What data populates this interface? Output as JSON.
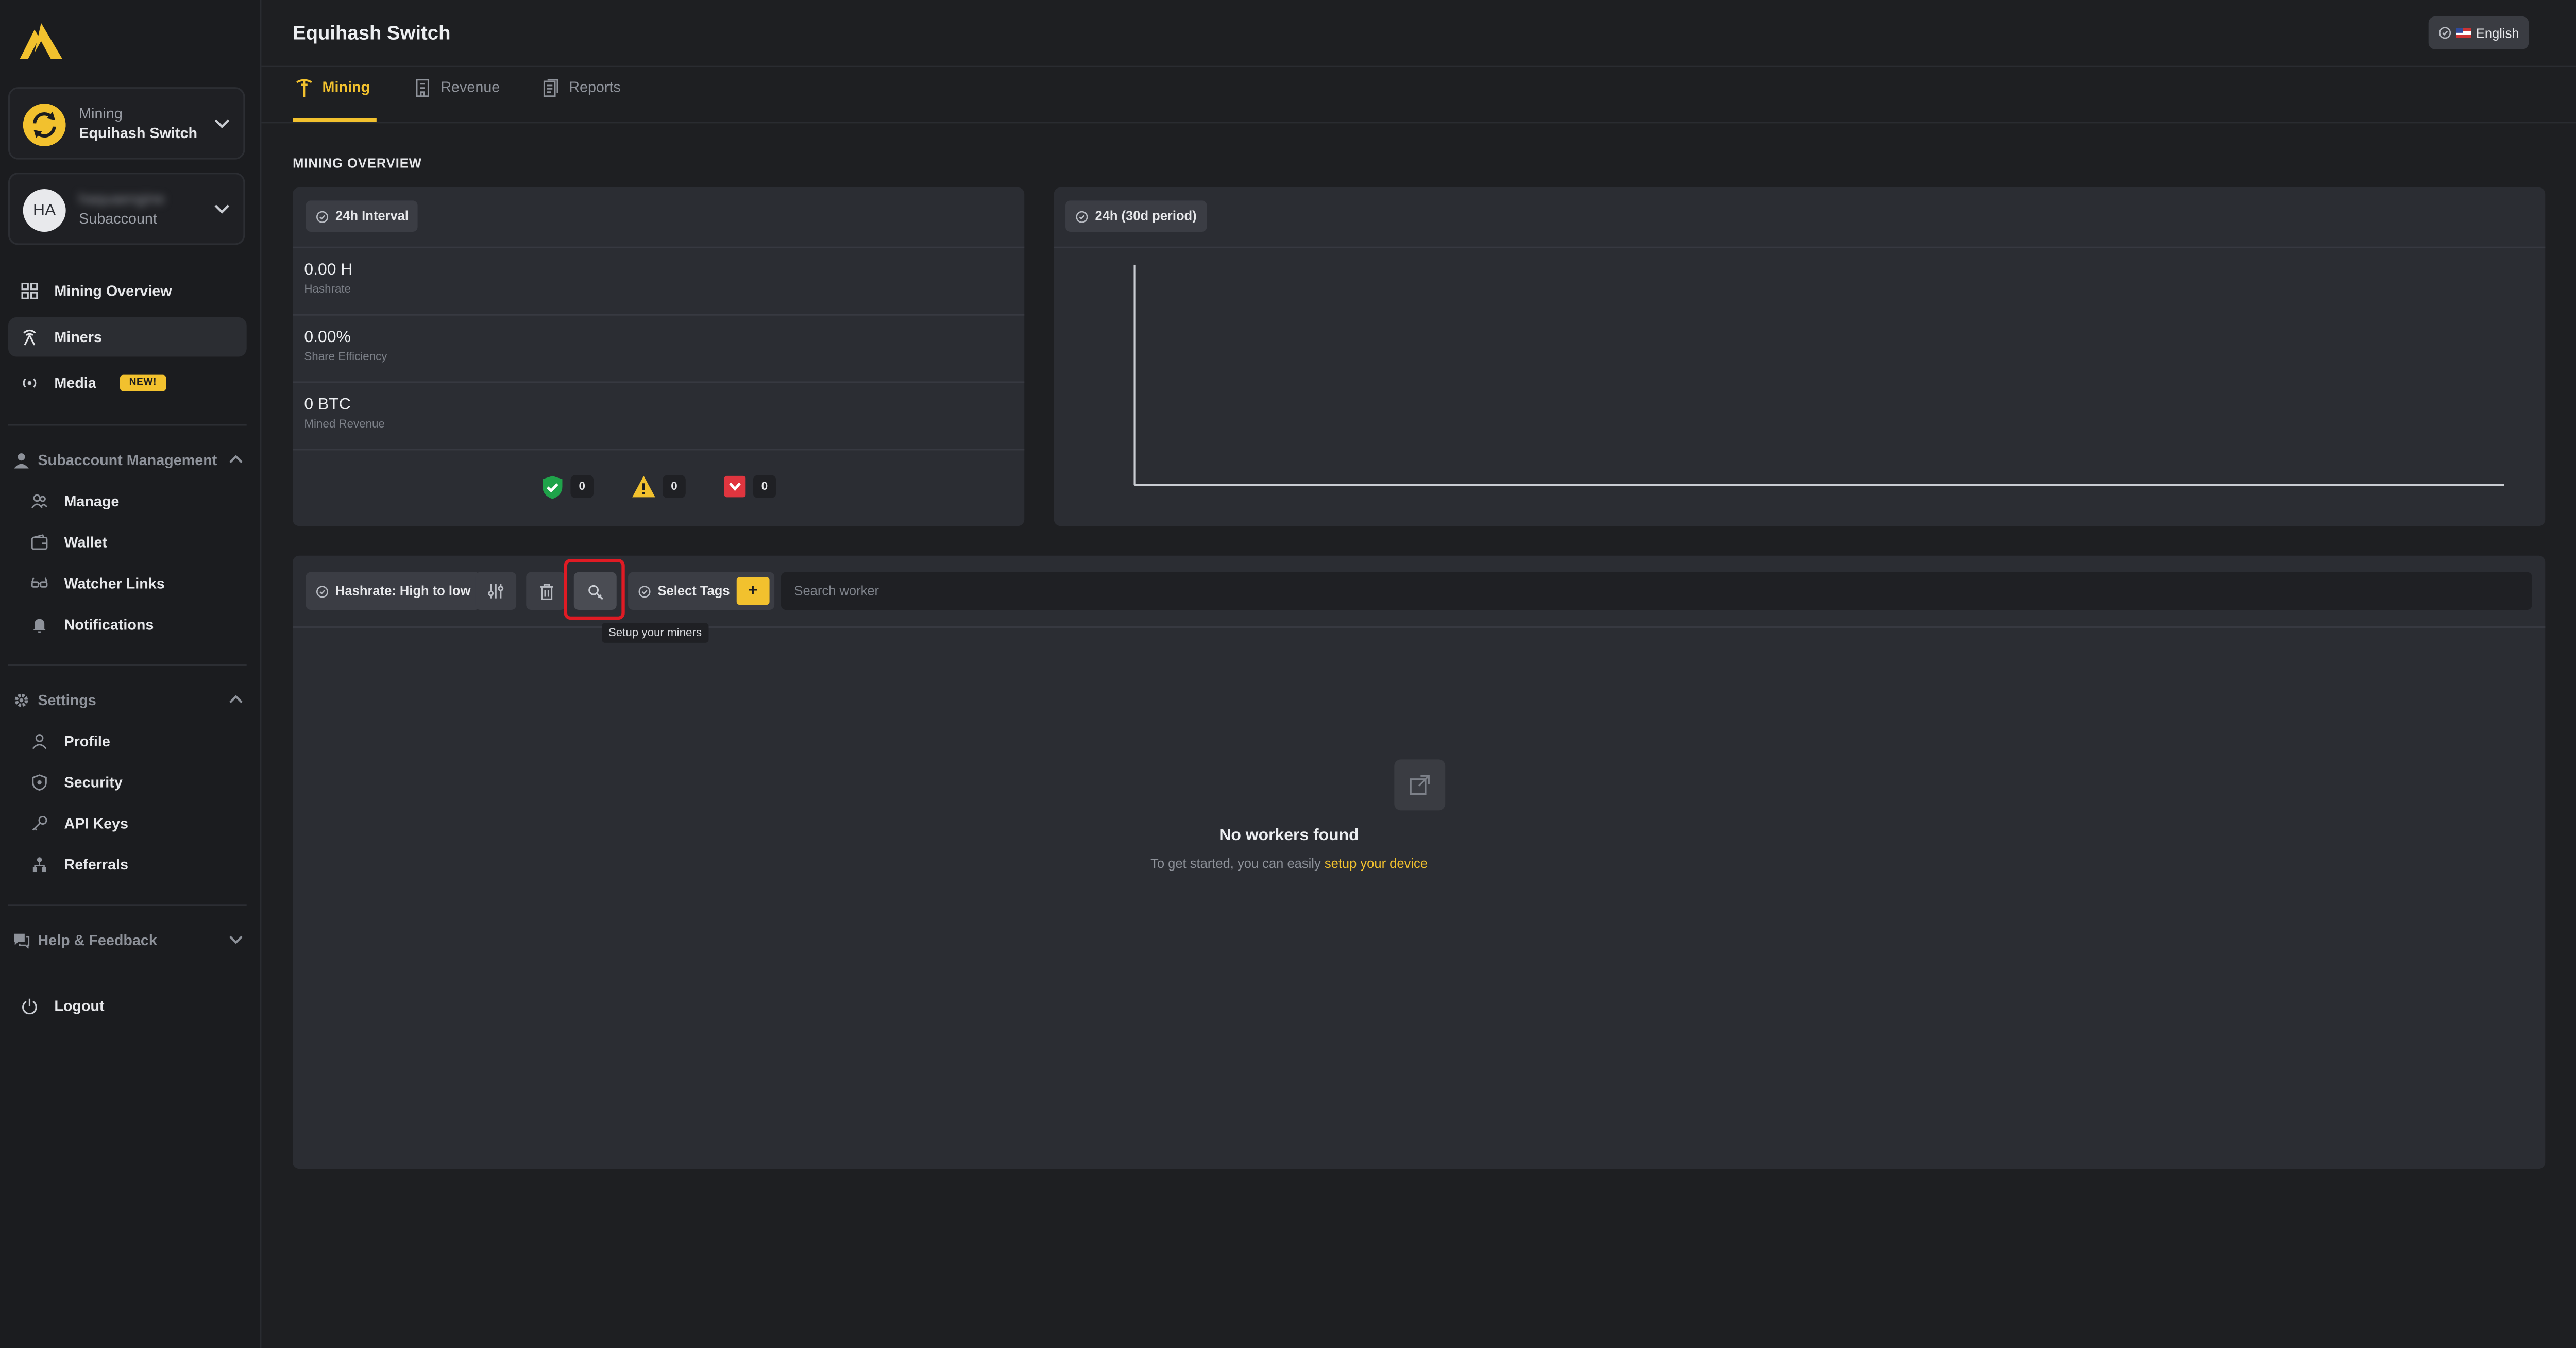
{
  "app": {
    "page_title": "Equihash Switch",
    "language": "English",
    "accent_color": "#f2c12e"
  },
  "sidebar": {
    "mining_card": {
      "label": "Mining",
      "value": "Equihash Switch"
    },
    "account_card": {
      "avatar": "HA",
      "name": "haquaengine",
      "role": "Subaccount"
    },
    "primary": [
      {
        "label": "Mining Overview",
        "icon": "grid-icon"
      },
      {
        "label": "Miners",
        "icon": "antenna-icon"
      },
      {
        "label": "Media",
        "icon": "broadcast-icon",
        "badge": "NEW!"
      }
    ],
    "subaccount_section": {
      "title": "Subaccount Management",
      "items": [
        {
          "label": "Manage",
          "icon": "users-icon"
        },
        {
          "label": "Wallet",
          "icon": "wallet-icon"
        },
        {
          "label": "Watcher Links",
          "icon": "glasses-icon"
        },
        {
          "label": "Notifications",
          "icon": "bell-icon"
        }
      ]
    },
    "settings_section": {
      "title": "Settings",
      "items": [
        {
          "label": "Profile",
          "icon": "user-icon"
        },
        {
          "label": "Security",
          "icon": "shield-icon"
        },
        {
          "label": "API Keys",
          "icon": "key-icon"
        },
        {
          "label": "Referrals",
          "icon": "referrals-icon"
        }
      ]
    },
    "help": {
      "title": "Help & Feedback"
    },
    "logout": {
      "label": "Logout"
    }
  },
  "tabs": [
    {
      "label": "Mining",
      "active": true
    },
    {
      "label": "Revenue",
      "active": false
    },
    {
      "label": "Reports",
      "active": false
    }
  ],
  "overview": {
    "section_title": "MINING OVERVIEW",
    "interval_chip": "24h Interval",
    "stats": [
      {
        "value": "0.00 H",
        "label": "Hashrate"
      },
      {
        "value": "0.00%",
        "label": "Share Efficiency"
      },
      {
        "value": "0 BTC",
        "label": "Mined Revenue"
      }
    ],
    "status_counts": {
      "active": "0",
      "warning": "0",
      "inactive": "0"
    },
    "chart_chip": "24h (30d period)"
  },
  "workers": {
    "sort_label": "Hashrate: High to low",
    "tags_label": "Select Tags",
    "add_tag": "+",
    "search_placeholder": "Search worker",
    "tooltip": "Setup your miners",
    "empty_title": "No workers found",
    "empty_text": "To get started, you can easily ",
    "empty_link": "setup your device"
  }
}
